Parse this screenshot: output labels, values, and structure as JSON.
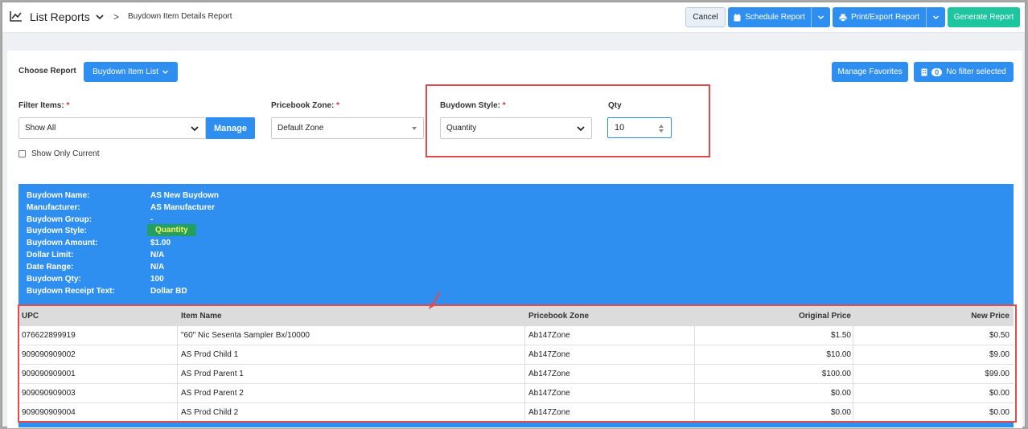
{
  "header": {
    "title": "List Reports",
    "separator": ">",
    "breadcrumb": "Buydown Item Details Report",
    "cancel_label": "Cancel",
    "schedule_label": "Schedule Report",
    "print_label": "Print/Export Report",
    "generate_label": "Generate Report"
  },
  "report": {
    "choose_label": "Choose Report",
    "choose_value": "Buydown Item List",
    "favorites_label": "Manage Favorites",
    "filter_count": "0",
    "filter_label": "No filter selected"
  },
  "filters": {
    "filter_items_label": "Filter Items:",
    "filter_items_value": "Show All",
    "manage_label": "Manage",
    "pricebook_label": "Pricebook Zone:",
    "pricebook_value": "Default Zone",
    "style_label": "Buydown Style:",
    "style_value": "Quantity",
    "qty_label": "Qty",
    "qty_value": "10",
    "show_current_label": "Show Only Current",
    "required_mark": "*"
  },
  "info": [
    {
      "key": "Buydown Name:",
      "value": "AS New Buydown"
    },
    {
      "key": "Manufacturer:",
      "value": "AS Manufacturer"
    },
    {
      "key": "Buydown Group:",
      "value": "-"
    },
    {
      "key": "Buydown Style:",
      "value": "Quantity"
    },
    {
      "key": "Buydown Amount:",
      "value": "$1.00"
    },
    {
      "key": "Dollar Limit:",
      "value": "N/A"
    },
    {
      "key": "Date Range:",
      "value": "N/A"
    },
    {
      "key": "Buydown Qty:",
      "value": "100"
    },
    {
      "key": "Buydown Receipt Text:",
      "value": "Dollar BD"
    }
  ],
  "table": {
    "columns": [
      "UPC",
      "Item Name",
      "Pricebook Zone",
      "Original Price",
      "New Price"
    ],
    "rows": [
      [
        "076622899919",
        "\"60\" Nic Sesenta Sampler Bx/10000",
        "Ab147Zone",
        "$1.50",
        "$0.50"
      ],
      [
        "909090909002",
        "AS Prod Child 1",
        "Ab147Zone",
        "$10.00",
        "$9.00"
      ],
      [
        "909090909001",
        "AS Prod Parent 1",
        "Ab147Zone",
        "$100.00",
        "$99.00"
      ],
      [
        "909090909003",
        "AS Prod Parent 2",
        "Ab147Zone",
        "$0.00",
        "$0.00"
      ],
      [
        "909090909004",
        "AS Prod Child 2",
        "Ab147Zone",
        "$0.00",
        "$0.00"
      ]
    ]
  },
  "colors": {
    "primary": "#2f8ff0",
    "success": "#1ec6a0",
    "highlight": "#e04b4b"
  }
}
